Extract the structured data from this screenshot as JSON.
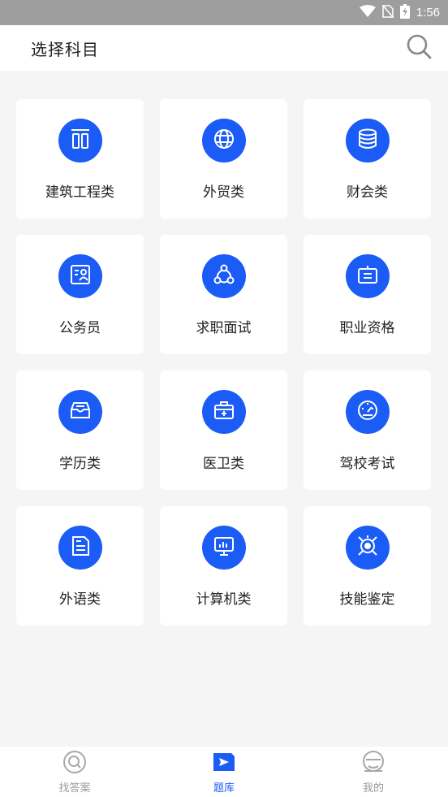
{
  "status_bar": {
    "time": "1:56"
  },
  "header": {
    "title": "选择科目",
    "search_icon": "search-icon"
  },
  "categories": [
    {
      "label": "建筑工程类",
      "icon": "columns-icon"
    },
    {
      "label": "外贸类",
      "icon": "globe-icon"
    },
    {
      "label": "财会类",
      "icon": "coins-stack-icon"
    },
    {
      "label": "公务员",
      "icon": "id-card-icon"
    },
    {
      "label": "求职面试",
      "icon": "network-icon"
    },
    {
      "label": "职业资格",
      "icon": "badge-icon"
    },
    {
      "label": "学历类",
      "icon": "inbox-icon"
    },
    {
      "label": "医卫类",
      "icon": "medical-kit-icon"
    },
    {
      "label": "驾校考试",
      "icon": "speedometer-icon"
    },
    {
      "label": "外语类",
      "icon": "document-icon"
    },
    {
      "label": "计算机类",
      "icon": "monitor-chart-icon"
    },
    {
      "label": "技能鉴定",
      "icon": "target-icon"
    }
  ],
  "tabbar": {
    "items": [
      {
        "label": "找答案",
        "icon": "search-answer-icon",
        "active": false
      },
      {
        "label": "题库",
        "icon": "play-flag-icon",
        "active": true
      },
      {
        "label": "我的",
        "icon": "profile-icon",
        "active": false
      }
    ]
  },
  "colors": {
    "accent": "#1a5cf5",
    "background": "#f5f5f5",
    "card": "#ffffff",
    "inactive": "#9a9a9a"
  }
}
